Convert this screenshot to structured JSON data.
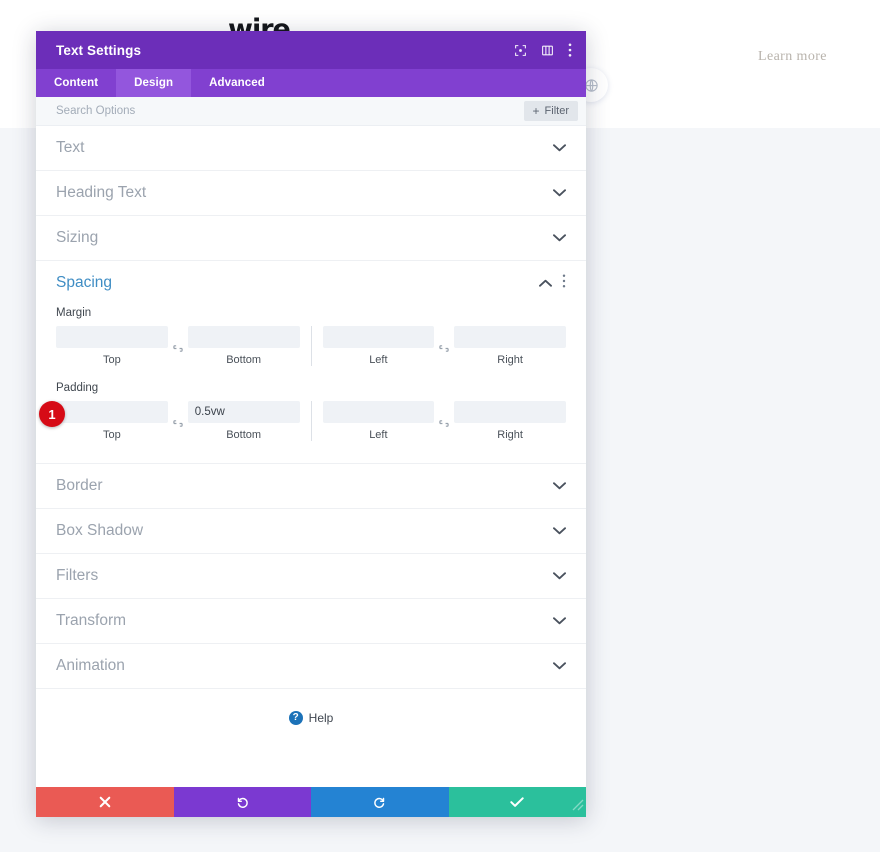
{
  "background": {
    "logo_text": "wire",
    "learn_more_label": "Learn more",
    "circle_button_icon": "globe-icon"
  },
  "modal": {
    "title": "Text Settings",
    "header_icons": [
      {
        "name": "focus-target-icon",
        "label": ""
      },
      {
        "name": "split-view-icon",
        "label": ""
      },
      {
        "name": "more-vertical-icon",
        "label": ""
      }
    ],
    "tabs": [
      {
        "label": "Content",
        "active": false
      },
      {
        "label": "Design",
        "active": true
      },
      {
        "label": "Advanced",
        "active": false
      }
    ],
    "search": {
      "placeholder": "Search Options",
      "value": ""
    },
    "filter_button": {
      "label": "Filter",
      "plus": "+"
    },
    "sections": [
      {
        "title": "Text",
        "open": false
      },
      {
        "title": "Heading Text",
        "open": false
      },
      {
        "title": "Sizing",
        "open": false
      },
      {
        "title": "Spacing",
        "open": true
      },
      {
        "title": "Border",
        "open": false
      },
      {
        "title": "Box Shadow",
        "open": false
      },
      {
        "title": "Filters",
        "open": false
      },
      {
        "title": "Transform",
        "open": false
      },
      {
        "title": "Animation",
        "open": false
      }
    ],
    "spacing": {
      "margin": {
        "label": "Margin",
        "top": {
          "label": "Top",
          "value": ""
        },
        "bottom": {
          "label": "Bottom",
          "value": ""
        },
        "left": {
          "label": "Left",
          "value": ""
        },
        "right": {
          "label": "Right",
          "value": ""
        }
      },
      "padding": {
        "label": "Padding",
        "top": {
          "label": "Top",
          "value": ""
        },
        "bottom": {
          "label": "Bottom",
          "value": "0.5vw"
        },
        "left": {
          "label": "Left",
          "value": ""
        },
        "right": {
          "label": "Right",
          "value": ""
        }
      }
    },
    "marker": {
      "number": "1"
    },
    "help": {
      "label": "Help",
      "icon_char": "?"
    },
    "footer": {
      "cancel": {
        "name": "cancel-button",
        "icon": "close-icon"
      },
      "undo": {
        "name": "undo-button",
        "icon": "undo-icon"
      },
      "redo": {
        "name": "redo-button",
        "icon": "redo-icon"
      },
      "save": {
        "name": "save-button",
        "icon": "check-icon"
      }
    },
    "colors": {
      "header_purple": "#6c2eb9",
      "tab_purple": "#8140d0",
      "tab_active_purple": "#9356dd",
      "accent_blue": "#3f8dc4",
      "cancel_red": "#ea5a54",
      "undo_purple": "#7b39d1",
      "redo_blue": "#2483d3",
      "save_green": "#2bc09c",
      "marker_red": "#d60b16"
    }
  }
}
